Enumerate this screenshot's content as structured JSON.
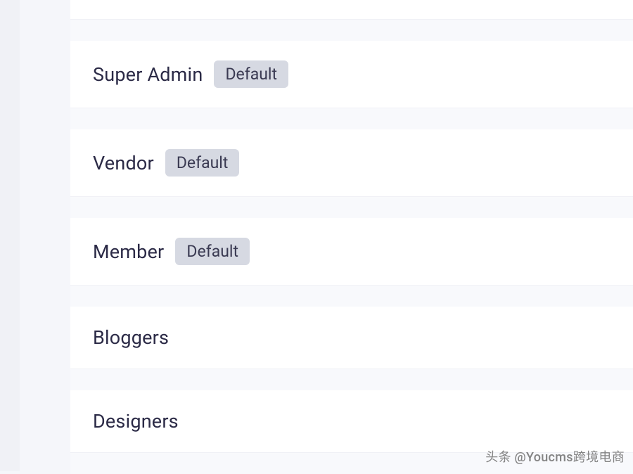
{
  "roles": [
    {
      "name": "Super Admin",
      "badge": "Default"
    },
    {
      "name": "Vendor",
      "badge": "Default"
    },
    {
      "name": "Member",
      "badge": "Default"
    },
    {
      "name": "Bloggers",
      "badge": null
    },
    {
      "name": "Designers",
      "badge": null
    }
  ],
  "watermark": "头条 @Youcms跨境电商"
}
